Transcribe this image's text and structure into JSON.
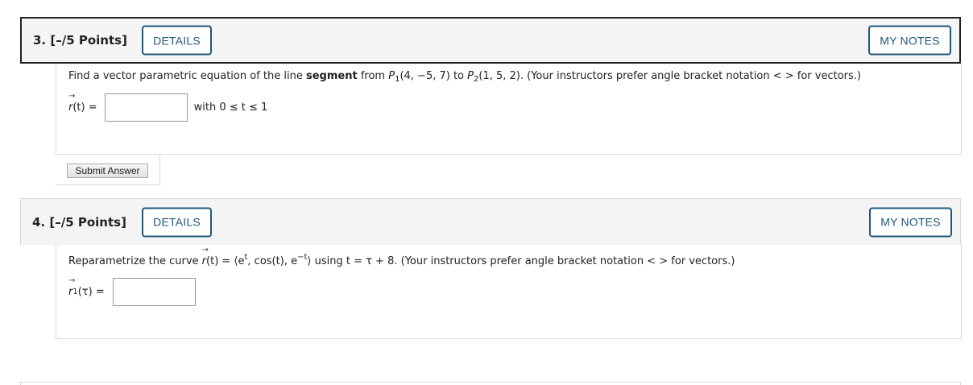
{
  "q3": {
    "title": "3. [–/5 Points]",
    "details_label": "DETAILS",
    "notes_label": "MY NOTES",
    "prompt_pre": "Find a vector parametric equation of the line ",
    "prompt_bold": "segment",
    "prompt_from": " from ",
    "p1_letter": "P",
    "p1_sub": "1",
    "p1_coords": "(4, −5, 7)",
    "to_text": " to ",
    "p2_letter": "P",
    "p2_sub": "2",
    "p2_coords": "(1, 5, 2)",
    "prompt_post": ". (Your instructors prefer angle bracket notation < > for vectors.)",
    "answer_label_var": "r",
    "answer_label_rest": "(t) =",
    "answer_value": "",
    "constraint": "with 0 ≤ t ≤ 1",
    "submit_label": "Submit Answer"
  },
  "q4": {
    "title": "4. [–/5 Points]",
    "details_label": "DETAILS",
    "notes_label": "MY NOTES",
    "prompt_pre": "Reparametrize the curve ",
    "curve_var": "r",
    "curve_rest": "(t) = ⟨e",
    "exp1": "t",
    "curve_mid": ", cos(t), e",
    "exp2": "−t",
    "curve_end": "⟩",
    "prompt_post": " using t = τ + 8. (Your instructors prefer angle bracket notation < > for vectors.)",
    "answer_label_var": "r",
    "answer_label_sub": "1",
    "answer_label_rest": "(τ) =",
    "answer_value": ""
  }
}
